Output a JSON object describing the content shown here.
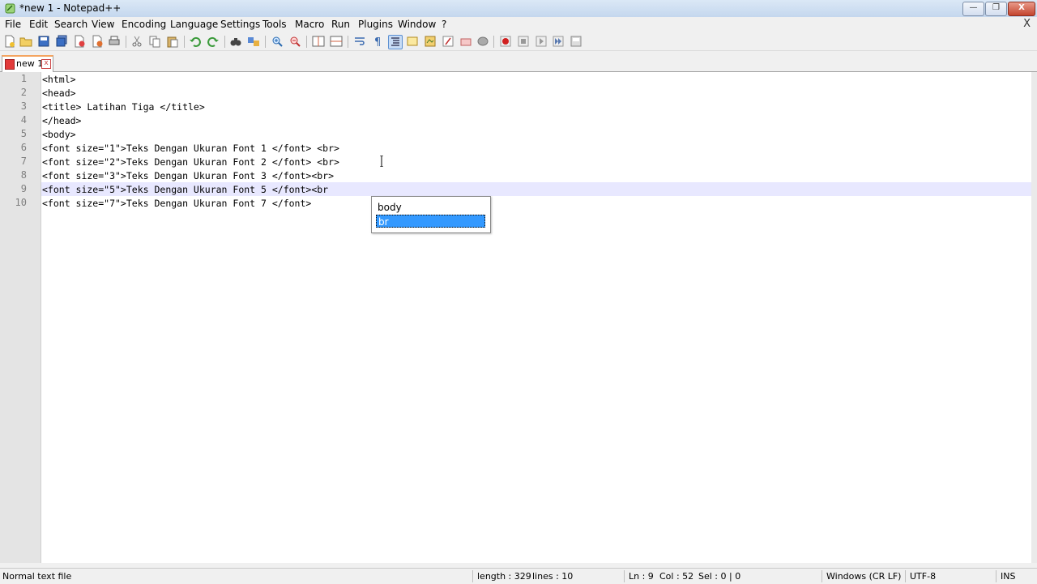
{
  "window": {
    "title": "*new 1 - Notepad++",
    "controls": {
      "minimize": "—",
      "restore": "❐",
      "close": "X"
    }
  },
  "menu": {
    "items": [
      "File",
      "Edit",
      "Search",
      "View",
      "Encoding",
      "Language",
      "Settings",
      "Tools",
      "Macro",
      "Run",
      "Plugins",
      "Window",
      "?"
    ],
    "doc_close": "X"
  },
  "toolbar": {
    "buttons": [
      "new-file",
      "open-file",
      "save",
      "save-all",
      "close",
      "close-all",
      "print",
      "cut",
      "copy",
      "paste",
      "undo",
      "redo",
      "find",
      "replace",
      "zoom-in",
      "zoom-out",
      "sync-vertical",
      "sync-horizontal",
      "word-wrap",
      "show-all-chars",
      "indent-guide",
      "user-define-lang",
      "doc-map",
      "function-list",
      "folder-workspace",
      "record-macro",
      "stop-record",
      "play-macro",
      "run-macro-multiple",
      "save-macro"
    ]
  },
  "tabs": [
    {
      "label": "new 1",
      "modified": true,
      "close": "x"
    }
  ],
  "editor": {
    "lines": [
      {
        "num": "1",
        "text": "<html>"
      },
      {
        "num": "2",
        "text": "<head>"
      },
      {
        "num": "3",
        "text": "<title> Latihan Tiga </title>"
      },
      {
        "num": "4",
        "text": "</head>"
      },
      {
        "num": "5",
        "text": "<body>"
      },
      {
        "num": "6",
        "text": "<font size=\"1\">Teks Dengan Ukuran Font 1 </font> <br>"
      },
      {
        "num": "7",
        "text": "<font size=\"2\">Teks Dengan Ukuran Font 2 </font> <br>"
      },
      {
        "num": "8",
        "text": "<font size=\"3\">Teks Dengan Ukuran Font 3 </font><br>"
      },
      {
        "num": "9",
        "text": "<font size=\"5\">Teks Dengan Ukuran Font 5 </font><br"
      },
      {
        "num": "10",
        "text": "<font size=\"7\">Teks Dengan Ukuran Font 7 </font>"
      }
    ],
    "current_line": 9
  },
  "autocomplete": {
    "items": [
      {
        "label": "body",
        "selected": false
      },
      {
        "label": "br",
        "selected": true
      }
    ]
  },
  "statusbar": {
    "file_type": "Normal text file",
    "length": "length : 329",
    "lines": "lines : 10",
    "ln": "Ln : 9",
    "col": "Col : 52",
    "sel": "Sel : 0 | 0",
    "eol": "Windows (CR LF)",
    "encoding": "UTF-8",
    "mode": "INS"
  },
  "colors": {
    "selection": "#3399ff",
    "current_line": "#e8e8ff",
    "tab_accent": "#f4a460"
  }
}
